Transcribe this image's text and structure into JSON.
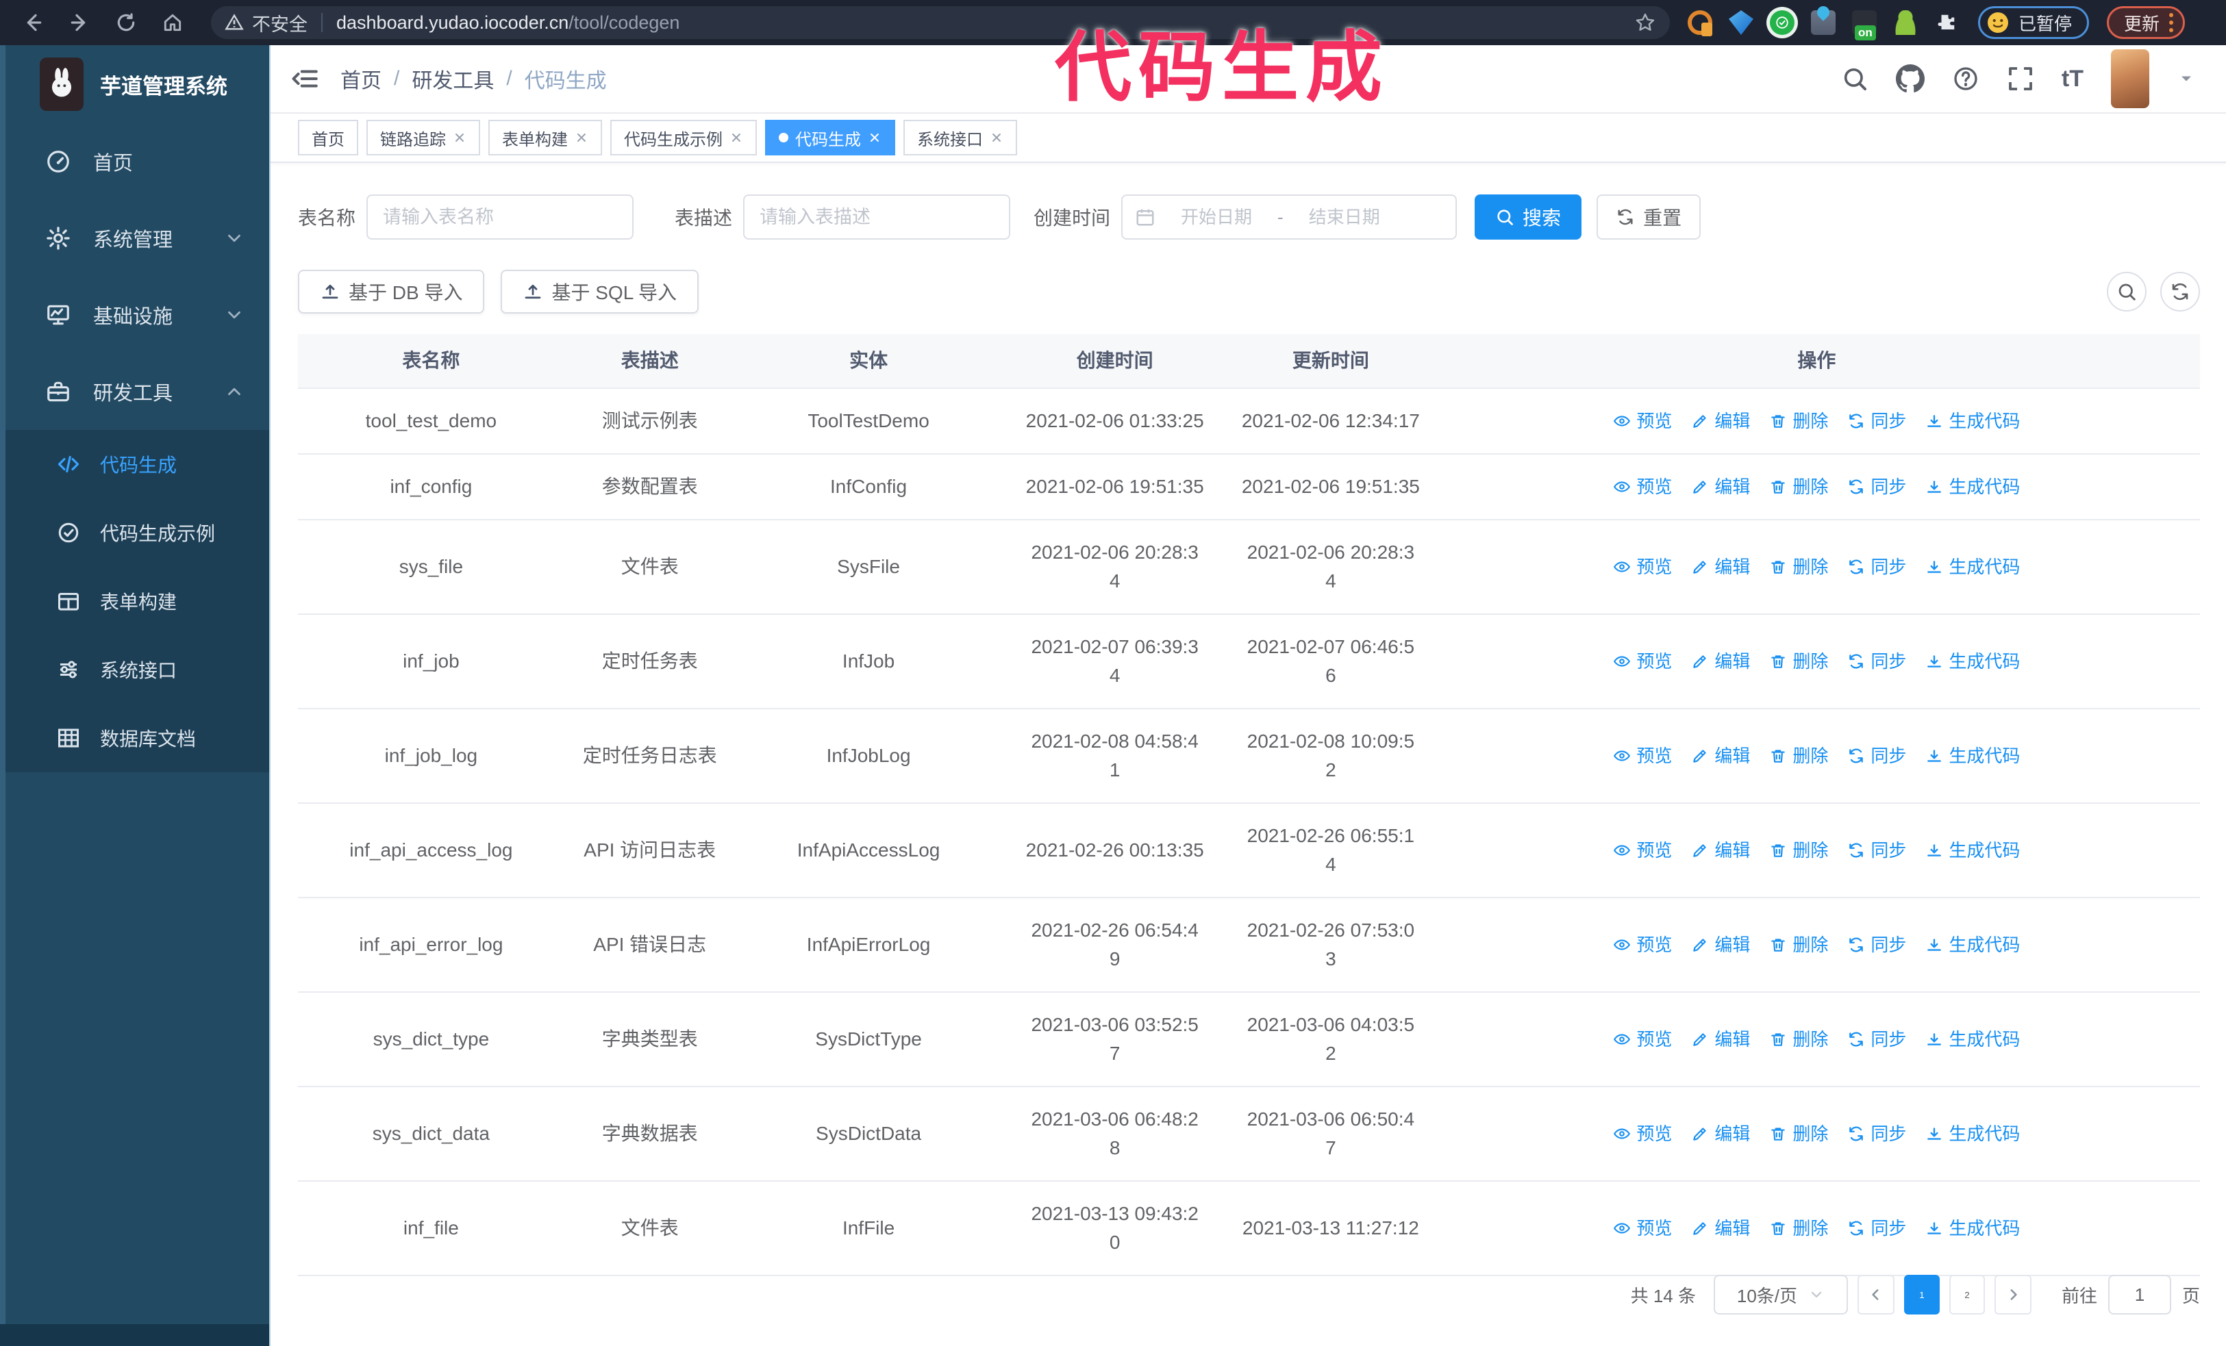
{
  "colors": {
    "primary": "#409eff",
    "link_blue": "#1890f2",
    "annotation_pink": "#f3305f",
    "sidebar_bg": "#234a63",
    "submenu_bg": "#1d3f56",
    "browser_bar_bg": "#1d2330"
  },
  "browser": {
    "security_label": "不安全",
    "url_host": "dashboard.yudao.iocoder.cn",
    "url_path": "/tool/codegen",
    "paused_badge": "已暂停",
    "update_label": "更新"
  },
  "annotation": {
    "text": "代码生成"
  },
  "sidebar": {
    "logo_title": "芋道管理系统",
    "items": [
      {
        "label": "首页"
      },
      {
        "label": "系统管理"
      },
      {
        "label": "基础设施"
      },
      {
        "label": "研发工具"
      }
    ],
    "submenu": [
      {
        "label": "代码生成"
      },
      {
        "label": "代码生成示例"
      },
      {
        "label": "表单构建"
      },
      {
        "label": "系统接口"
      },
      {
        "label": "数据库文档"
      }
    ]
  },
  "navbar": {
    "breadcrumb": [
      "首页",
      "研发工具",
      "代码生成"
    ]
  },
  "tabs": [
    {
      "label": "首页"
    },
    {
      "label": "链路追踪"
    },
    {
      "label": "表单构建"
    },
    {
      "label": "代码生成示例"
    },
    {
      "label": "代码生成"
    },
    {
      "label": "系统接口"
    }
  ],
  "filters": {
    "name_label": "表名称",
    "name_placeholder": "请输入表名称",
    "desc_label": "表描述",
    "desc_placeholder": "请输入表描述",
    "time_label": "创建时间",
    "start_placeholder": "开始日期",
    "range_separator": "-",
    "end_placeholder": "结束日期",
    "search_label": "搜索",
    "reset_label": "重置"
  },
  "toolbar": {
    "import_db_label": "基于 DB 导入",
    "import_sql_label": "基于 SQL 导入"
  },
  "table": {
    "columns": [
      "表名称",
      "表描述",
      "实体",
      "创建时间",
      "更新时间",
      "操作"
    ],
    "actions": [
      {
        "label": "预览",
        "icon": "i-eye"
      },
      {
        "label": "编辑",
        "icon": "i-edit"
      },
      {
        "label": "删除",
        "icon": "i-trash"
      },
      {
        "label": "同步",
        "icon": "i-sync"
      },
      {
        "label": "生成代码",
        "icon": "i-download"
      }
    ],
    "rows": [
      {
        "name": "tool_test_demo",
        "desc": "测试示例表",
        "entity": "ToolTestDemo",
        "created": "2021-02-06 01:33:25",
        "updated": "2021-02-06 12:34:17"
      },
      {
        "name": "inf_config",
        "desc": "参数配置表",
        "entity": "InfConfig",
        "created": "2021-02-06 19:51:35",
        "updated": "2021-02-06 19:51:35"
      },
      {
        "name": "sys_file",
        "desc": "文件表",
        "entity": "SysFile",
        "created": "2021-02-06 20:28:3\n4",
        "updated": "2021-02-06 20:28:3\n4"
      },
      {
        "name": "inf_job",
        "desc": "定时任务表",
        "entity": "InfJob",
        "created": "2021-02-07 06:39:3\n4",
        "updated": "2021-02-07 06:46:5\n6"
      },
      {
        "name": "inf_job_log",
        "desc": "定时任务日志表",
        "entity": "InfJobLog",
        "created": "2021-02-08 04:58:4\n1",
        "updated": "2021-02-08 10:09:5\n2"
      },
      {
        "name": "inf_api_access_log",
        "desc": "API 访问日志表",
        "entity": "InfApiAccessLog",
        "created": "2021-02-26 00:13:35",
        "updated": "2021-02-26 06:55:1\n4"
      },
      {
        "name": "inf_api_error_log",
        "desc": "API 错误日志",
        "entity": "InfApiErrorLog",
        "created": "2021-02-26 06:54:4\n9",
        "updated": "2021-02-26 07:53:0\n3"
      },
      {
        "name": "sys_dict_type",
        "desc": "字典类型表",
        "entity": "SysDictType",
        "created": "2021-03-06 03:52:5\n7",
        "updated": "2021-03-06 04:03:5\n2"
      },
      {
        "name": "sys_dict_data",
        "desc": "字典数据表",
        "entity": "SysDictData",
        "created": "2021-03-06 06:48:2\n8",
        "updated": "2021-03-06 06:50:4\n7"
      },
      {
        "name": "inf_file",
        "desc": "文件表",
        "entity": "InfFile",
        "created": "2021-03-13 09:43:2\n0",
        "updated": "2021-03-13 11:27:12"
      }
    ]
  },
  "pagination": {
    "total": "共 14 条",
    "page_size": "10条/页",
    "pages": [
      "1",
      "2"
    ],
    "active_page": "1",
    "goto_label": "前往",
    "goto_value": "1",
    "page_suffix": "页"
  }
}
